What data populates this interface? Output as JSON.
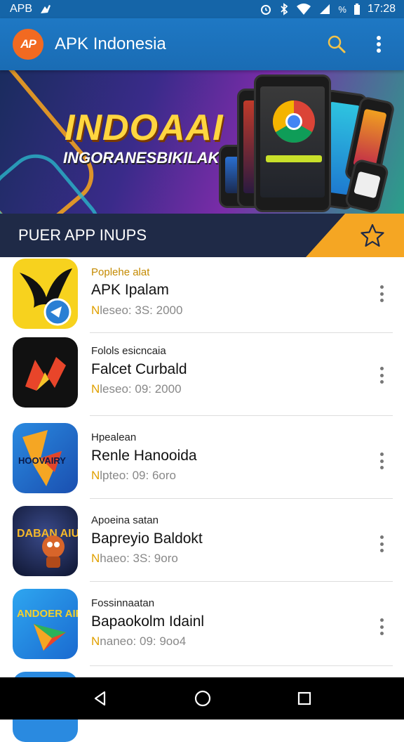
{
  "status_bar": {
    "left_text": "APB",
    "time": "17:28",
    "battery_text": "%"
  },
  "app_bar": {
    "title": "APK Indonesia",
    "logo_text": "AP",
    "icons": [
      "search-icon",
      "more-vert-icon"
    ]
  },
  "banner": {
    "title": "INDOAAI",
    "subtitle": "INGORANESBIKILAK"
  },
  "section": {
    "title": "PUER APP INUPS",
    "icon": "star-icon",
    "accent_color": "#f5a623"
  },
  "apps": [
    {
      "category": "Poplehe alat",
      "name": "APK Ipalam",
      "meta": "Nleseo: 3S: 2000"
    },
    {
      "category": "Folols esicncaia",
      "name": "Falcet Curbald",
      "meta": "Nleseo: 09: 2000"
    },
    {
      "category": "Hpealean",
      "name": "Renle Hanooida",
      "meta": "Nlpteo: 09: 6oro"
    },
    {
      "category": "Apoeina satan",
      "name": "Bapreyio Baldokt",
      "meta": "Nhaeo: 3S: 9oro"
    },
    {
      "category": "Fossinnaatan",
      "name": "Bapaokolm Idainl",
      "meta": "Nnaneo: 09: 9oo4"
    }
  ],
  "app_icon_texts": {
    "icon3": "HOOVAIRY",
    "icon4": "DABAN AIUN",
    "icon5": "ANDOER AIRID"
  },
  "nav_bar": {
    "icons": [
      "back-icon",
      "home-icon",
      "recents-icon"
    ]
  }
}
